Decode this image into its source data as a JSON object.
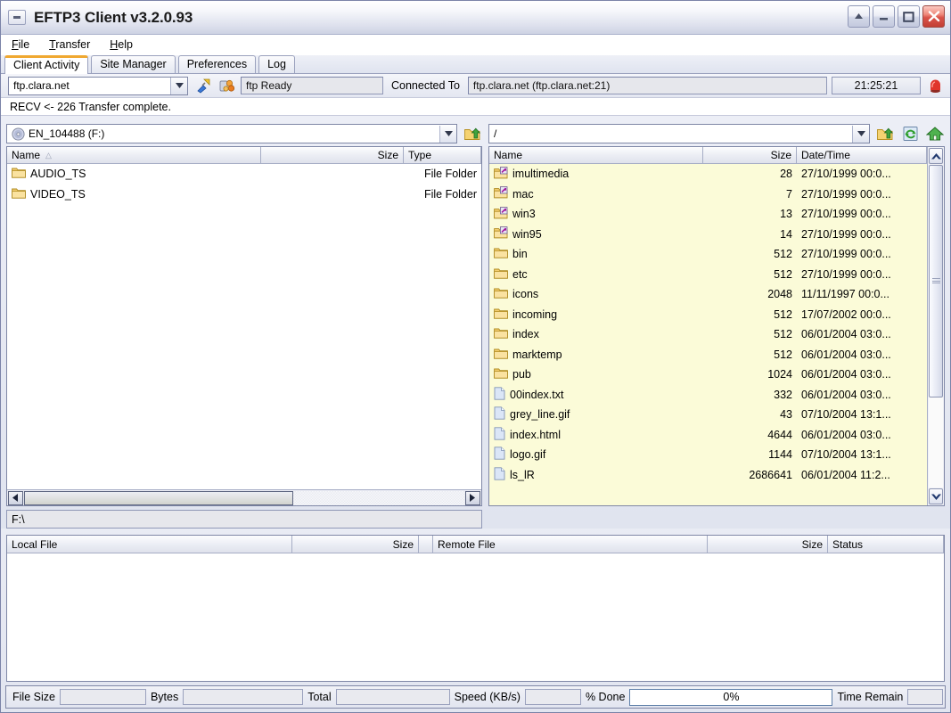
{
  "window": {
    "title": "EFTP3 Client v3.2.0.93",
    "buttons": {
      "rollup": "roll-up",
      "minimize": "minimize",
      "maximize": "maximize",
      "close": "close"
    }
  },
  "menu": {
    "items": [
      "File",
      "Transfer",
      "Help"
    ]
  },
  "tabs": {
    "items": [
      {
        "label": "Client Activity",
        "active": true
      },
      {
        "label": "Site Manager",
        "active": false
      },
      {
        "label": "Preferences",
        "active": false
      },
      {
        "label": "Log",
        "active": false
      }
    ],
    "active_accent": "#f0a830"
  },
  "connection": {
    "site": "ftp.clara.net",
    "connect_icon": "connect-plug-icon",
    "disconnect_icon": "disconnect-icon",
    "status": "ftp Ready",
    "connected_label": "Connected To",
    "connected_value": "ftp.clara.net (ftp.clara.net:21)",
    "clock": "21:25:21",
    "abort_icon": "stop-light-icon"
  },
  "log": {
    "line": "RECV <-  226 Transfer complete."
  },
  "local": {
    "drive": "EN_104488 (F:)",
    "drive_icon": "cd-drive-icon",
    "up_icon": "parent-folder-icon",
    "columns": [
      "Name",
      "Size",
      "Type"
    ],
    "sort_column": "Name",
    "sort_mark": "△",
    "rows": [
      {
        "name": "AUDIO_TS",
        "size": "",
        "type": "File Folder",
        "icon": "folder-icon"
      },
      {
        "name": "VIDEO_TS",
        "size": "",
        "type": "File Folder",
        "icon": "folder-icon"
      }
    ],
    "path": "F:\\"
  },
  "remote": {
    "path": "/",
    "up_icon": "parent-folder-icon",
    "refresh_icon": "refresh-icon",
    "home_icon": "home-icon",
    "columns": [
      "Name",
      "Size",
      "Date/Time"
    ],
    "rows": [
      {
        "name": "imultimedia",
        "size": "28",
        "date": "27/10/1999 00:0...",
        "icon": "folder-link-icon"
      },
      {
        "name": "mac",
        "size": "7",
        "date": "27/10/1999 00:0...",
        "icon": "folder-link-icon"
      },
      {
        "name": "win3",
        "size": "13",
        "date": "27/10/1999 00:0...",
        "icon": "folder-link-icon"
      },
      {
        "name": "win95",
        "size": "14",
        "date": "27/10/1999 00:0...",
        "icon": "folder-link-icon"
      },
      {
        "name": "bin",
        "size": "512",
        "date": "27/10/1999 00:0...",
        "icon": "folder-icon"
      },
      {
        "name": "etc",
        "size": "512",
        "date": "27/10/1999 00:0...",
        "icon": "folder-icon"
      },
      {
        "name": "icons",
        "size": "2048",
        "date": "11/11/1997 00:0...",
        "icon": "folder-icon"
      },
      {
        "name": "incoming",
        "size": "512",
        "date": "17/07/2002 00:0...",
        "icon": "folder-icon"
      },
      {
        "name": "index",
        "size": "512",
        "date": "06/01/2004 03:0...",
        "icon": "folder-icon"
      },
      {
        "name": "marktemp",
        "size": "512",
        "date": "06/01/2004 03:0...",
        "icon": "folder-icon"
      },
      {
        "name": "pub",
        "size": "1024",
        "date": "06/01/2004 03:0...",
        "icon": "folder-icon"
      },
      {
        "name": "00index.txt",
        "size": "332",
        "date": "06/01/2004 03:0...",
        "icon": "file-icon"
      },
      {
        "name": "grey_line.gif",
        "size": "43",
        "date": "07/10/2004 13:1...",
        "icon": "file-icon"
      },
      {
        "name": "index.html",
        "size": "4644",
        "date": "06/01/2004 03:0...",
        "icon": "file-icon"
      },
      {
        "name": "logo.gif",
        "size": "1144",
        "date": "07/10/2004 13:1...",
        "icon": "file-icon"
      },
      {
        "name": "ls_lR",
        "size": "2686641",
        "date": "06/01/2004 11:2...",
        "icon": "file-icon"
      }
    ],
    "list_background": "#fbfbd8"
  },
  "queue": {
    "columns": [
      "Local File",
      "Size",
      "",
      "Remote File",
      "Size",
      "Status"
    ],
    "rows": []
  },
  "statusbar": {
    "file_size_label": "File Size",
    "file_size_value": "",
    "bytes_label": "Bytes",
    "bytes_value": "",
    "total_label": "Total",
    "total_value": "",
    "speed_label": "Speed (KB/s)",
    "speed_value": "",
    "percent_label": "% Done",
    "percent_value": "0%",
    "time_remain_label": "Time Remain",
    "time_remain_value": ""
  }
}
